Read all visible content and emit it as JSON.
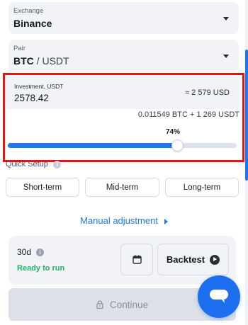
{
  "exchange": {
    "label": "Exchange",
    "value": "Binance"
  },
  "pair": {
    "label": "Pair",
    "base": "BTC",
    "separator": " / ",
    "quote": "USDT"
  },
  "investment": {
    "label": "Investment, USDT",
    "value": "2578.42",
    "approx": "≈ 2 579 USD",
    "breakdown": "0.011549 BTC + 1 269 USDT",
    "percent_label": "74%",
    "slider_fraction": 0.74
  },
  "quick_setup": {
    "label": "Quick Setup",
    "info": "i",
    "options": [
      "Short-term",
      "Mid-term",
      "Long-term"
    ]
  },
  "manual_adjustment": "Manual adjustment",
  "summary": {
    "period": "30d",
    "info": "i",
    "status": "Ready to run",
    "backtest_label": "Backtest"
  },
  "continue_label": "Continue",
  "colors": {
    "accent": "#1e78e6",
    "highlight": "#e51414",
    "status_ready": "#22b36a",
    "chat": "#1e6ff0"
  },
  "icons": {
    "select_caret": "caret-down-icon",
    "calendar": "calendar-icon",
    "backtest": "play-icon",
    "continue": "lock-icon",
    "chat": "chat-icon",
    "manual": "chevron-right-icon"
  }
}
